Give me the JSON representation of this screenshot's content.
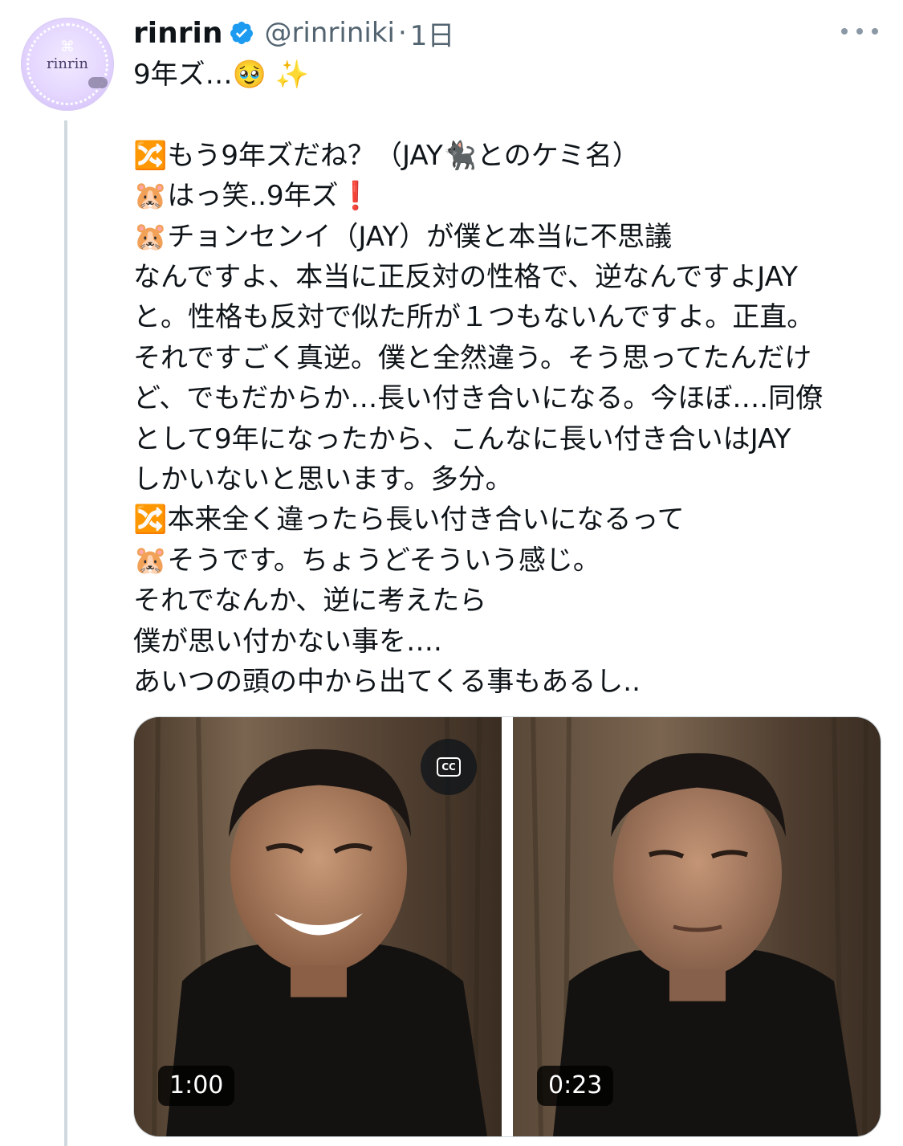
{
  "author": {
    "display_name": "rinrin",
    "handle": "@rinriniki",
    "separator": "·",
    "time": "1日",
    "avatar_text": "rinrin"
  },
  "tweet": {
    "text": "9年ズ…🥹 ✨\n\n🔀もう9年ズだね？（JAY🐈‍⬛とのケミ名）\n🐹はっ笑..9年ズ❗\n🐹チョンセンイ（JAY）が僕と本当に不思議\nなんですよ、本当に正反対の性格で、逆なんですよJAY\nと。性格も反対で似た所が１つもないんですよ。正直。\nそれですごく真逆。僕と全然違う。そう思ってたんだけ\nど、でもだからか…長い付き合いになる。今ほぼ….同僚\nとして9年になったから、こんなに長い付き合いはJAY\nしかいないと思います。多分。\n🔀本来全く違ったら長い付き合いになるって\n🐹そうです。ちょうどそういう感じ。\nそれでなんか、逆に考えたら\n僕が思い付かない事を….\nあいつの頭の中から出てくる事もあるし.."
  },
  "media": {
    "videos": [
      {
        "duration": "1:00"
      },
      {
        "duration": "0:23"
      }
    ],
    "cc_label": "CC"
  },
  "colors": {
    "verified": "#1d9bf0",
    "secondary_text": "#536471",
    "thread_line": "#cfd9de"
  }
}
